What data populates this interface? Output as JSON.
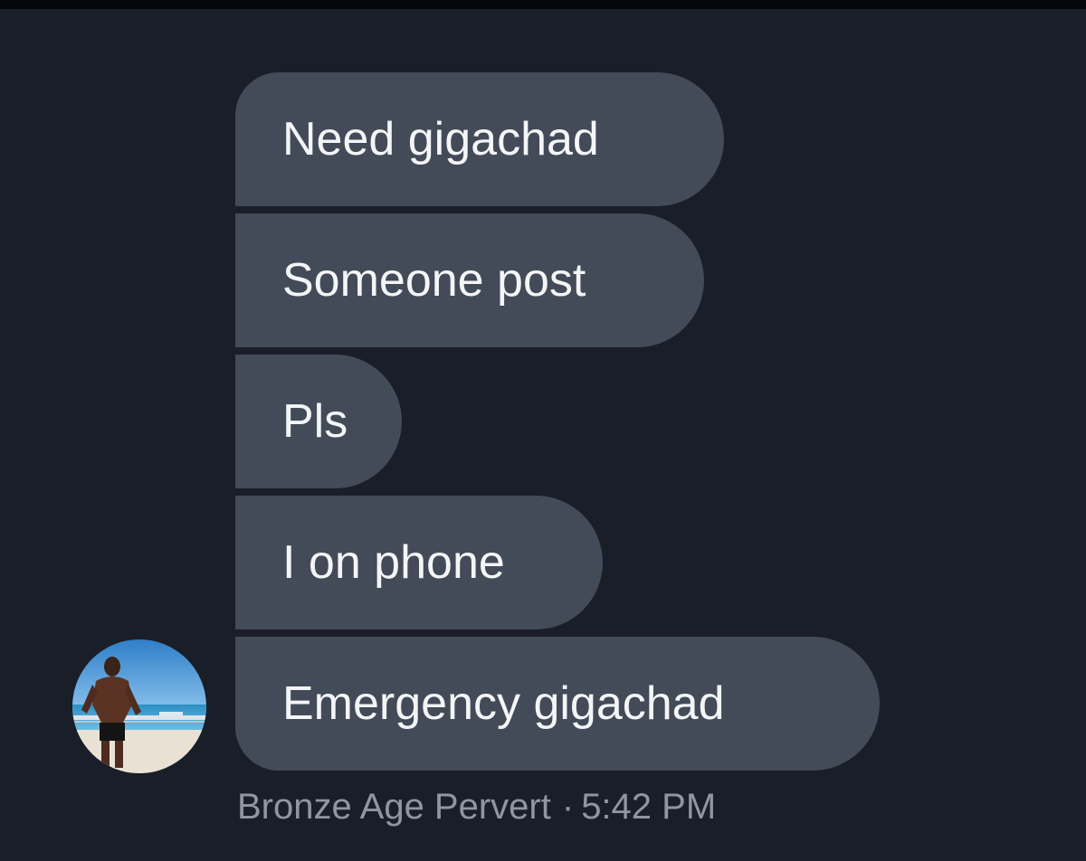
{
  "messages": [
    {
      "text": "Need gigachad"
    },
    {
      "text": "Someone post"
    },
    {
      "text": "Pls"
    },
    {
      "text": "I on phone"
    },
    {
      "text": "Emergency gigachad"
    }
  ],
  "sender": {
    "name": "Bronze Age Pervert",
    "separator": "·",
    "time": "5:42 PM",
    "avatar_icon": "beach-photo-avatar"
  },
  "colors": {
    "background": "#1a1e28",
    "bubble": "#434b58",
    "bubble_text": "#f4f5f7",
    "meta_text": "#8f96a3"
  }
}
